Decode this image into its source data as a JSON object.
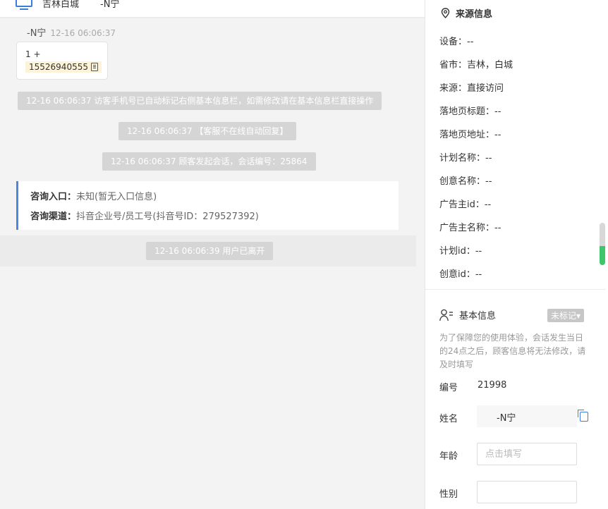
{
  "chat": {
    "header_location": "吉林白城",
    "header_name": "-N宁",
    "sender_name": "-N宁",
    "sender_time": "12-16 06:06:37",
    "bubble_line1": "1 +",
    "bubble_phone": "15526940555",
    "sys_messages": [
      "12-16 06:06:37 访客手机号已自动标记右侧基本信息栏，如需修改请在基本信息栏直接操作",
      "12-16 06:06:37 【客服不在线自动回复】",
      "12-16 06:06:37 顾客发起会话，会话编号：25864"
    ],
    "consult_entry_label": "咨询入口：",
    "consult_entry_value": "未知(暂无入口信息)",
    "consult_channel_label": "咨询渠道：",
    "consult_channel_value": "抖音企业号/员工号(抖音号ID：279527392)",
    "leave_message": "12-16 06:06:39 用户已离开"
  },
  "source": {
    "title": "来源信息",
    "items": [
      "设备：--",
      "省市：吉林，白城",
      "来源：直接访问",
      "落地页标题：--",
      "落地页地址：--",
      "计划名称：--",
      "创意名称：--",
      "广告主id：--",
      "广告主名称：--",
      "计划id：--",
      "创意id：--"
    ]
  },
  "basic": {
    "title": "基本信息",
    "badge": "未标记▾",
    "hint": "为了保障您的使用体验，会话发生当日的24点之后，顾客信息将无法修改，请及时填写",
    "id_label": "编号",
    "id_value": "21998",
    "name_label": "姓名",
    "name_value": "-N宁",
    "age_label": "年龄",
    "age_placeholder": "点击填写",
    "gender_label": "性别",
    "gender_value": ""
  },
  "colors": {
    "accent": "#3b7ddd",
    "scroll_green": "#3fc56a",
    "badge_grey": "#c7c7c7"
  }
}
